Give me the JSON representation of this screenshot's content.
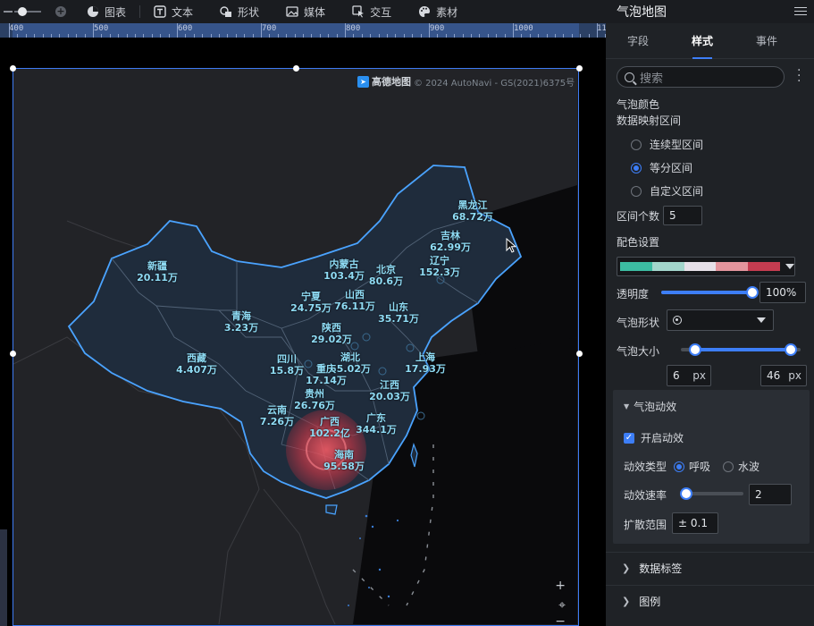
{
  "toolbar": {
    "items": [
      {
        "label": "图表",
        "icon": "pie-chart-icon"
      },
      {
        "label": "文本",
        "icon": "text-icon"
      },
      {
        "label": "形状",
        "icon": "shape-icon"
      },
      {
        "label": "媒体",
        "icon": "image-icon"
      },
      {
        "label": "交互",
        "icon": "interaction-icon"
      },
      {
        "label": "素材",
        "icon": "palette-icon"
      }
    ]
  },
  "ruler": {
    "labels": [
      "400",
      "500",
      "600",
      "700",
      "800",
      "900",
      "1000",
      "11"
    ]
  },
  "map": {
    "brand": "高德地图",
    "copyright": "© 2024 AutoNavi - GS(2021)6375号",
    "provinces": [
      {
        "name": "黑龙江",
        "value": "68.72万"
      },
      {
        "name": "吉林",
        "value": "62.99万"
      },
      {
        "name": "辽宁",
        "value": "152.3万"
      },
      {
        "name": "新疆",
        "value": "20.11万"
      },
      {
        "name": "内蒙古",
        "value": "103.4万"
      },
      {
        "name": "北京",
        "value": "80.6万"
      },
      {
        "name": "宁夏",
        "value": "24.75万"
      },
      {
        "name": "山西",
        "value": "76.11万"
      },
      {
        "name": "山东",
        "value": "35.71万"
      },
      {
        "name": "青海",
        "value": "3.23万"
      },
      {
        "name": "陕西",
        "value": "29.02万"
      },
      {
        "name": "西藏",
        "value": "4.407万"
      },
      {
        "name": "四川",
        "value": "15.8万"
      },
      {
        "name": "湖北",
        "value": "55.02万"
      },
      {
        "name": "上海",
        "value": "17.93万"
      },
      {
        "name": "重庆",
        "value": "17.14万"
      },
      {
        "name": "贵州",
        "value": "26.76万"
      },
      {
        "name": "江西",
        "value": "20.03万"
      },
      {
        "name": "云南",
        "value": "7.26万"
      },
      {
        "name": "广西",
        "value": "102.2亿"
      },
      {
        "name": "广东",
        "value": "344.1万"
      },
      {
        "name": "海南",
        "value": "95.58万"
      }
    ]
  },
  "panel": {
    "title": "气泡地图",
    "tabs": [
      "字段",
      "样式",
      "事件"
    ],
    "active_tab": "样式",
    "search_placeholder": "搜索",
    "bubble_color_label": "气泡颜色",
    "mapping_label": "数据映射区间",
    "mapping_options": [
      "连续型区间",
      "等分区间",
      "自定义区间"
    ],
    "mapping_selected": "等分区间",
    "interval_count_label": "区间个数",
    "interval_count": "5",
    "color_setting_label": "配色设置",
    "palette_colors": [
      "#3cbca2",
      "#a3d6cc",
      "#e6e0e8",
      "#e3959d",
      "#c43c50"
    ],
    "opacity_label": "透明度",
    "opacity_value": "100%",
    "opacity": 1.0,
    "shape_label": "气泡形状",
    "size_label": "气泡大小",
    "size_min": "6",
    "size_max": "46",
    "size_unit": "px",
    "size_range": [
      6,
      46
    ],
    "animation": {
      "title": "气泡动效",
      "enable_label": "开启动效",
      "enabled": true,
      "type_label": "动效类型",
      "type_options": [
        "呼吸",
        "水波"
      ],
      "type_selected": "呼吸",
      "speed_label": "动效速率",
      "speed_value": "2",
      "range_label": "扩散范围",
      "range_value": "± 0.1"
    },
    "sections": [
      "数据标签",
      "图例"
    ]
  },
  "colors": {
    "accent": "#3d7ef7",
    "label": "#8fdcf5",
    "land": "#1f2c3c",
    "border": "#4aa3ff"
  }
}
